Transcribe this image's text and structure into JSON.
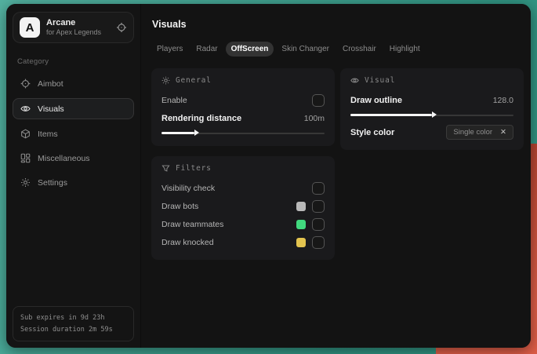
{
  "colors": {
    "background_teal": "#37a591",
    "background_red": "#dc5038",
    "swatch_gray": "#b9b9b9",
    "swatch_green": "#41d97e",
    "swatch_yellow": "#e3c44f"
  },
  "app": {
    "initial": "A",
    "name": "Arcane",
    "subtitle": "for Apex Legends"
  },
  "sidebar": {
    "category_label": "Category",
    "items": [
      {
        "label": "Aimbot",
        "icon": "crosshair-icon"
      },
      {
        "label": "Visuals",
        "icon": "eye-icon",
        "selected": true
      },
      {
        "label": "Items",
        "icon": "cube-icon"
      },
      {
        "label": "Miscellaneous",
        "icon": "grid-icon"
      },
      {
        "label": "Settings",
        "icon": "gear-icon"
      }
    ],
    "footer": {
      "sub_expires": "Sub expires in 9d 23h",
      "session_duration": "Session duration 2m 59s"
    }
  },
  "main": {
    "title": "Visuals",
    "tabs": [
      {
        "label": "Players"
      },
      {
        "label": "Radar"
      },
      {
        "label": "OffScreen",
        "active": true
      },
      {
        "label": "Skin Changer"
      },
      {
        "label": "Crosshair"
      },
      {
        "label": "Highlight"
      }
    ],
    "general": {
      "title": "General",
      "enable_label": "Enable",
      "rendering_distance_label": "Rendering distance",
      "rendering_distance_value": "100m"
    },
    "filters": {
      "title": "Filters",
      "rows": [
        {
          "label": "Visibility check"
        },
        {
          "label": "Draw bots",
          "swatch": "#b9b9b9"
        },
        {
          "label": "Draw teammates",
          "swatch": "#41d97e"
        },
        {
          "label": "Draw knocked",
          "swatch": "#e3c44f"
        }
      ]
    },
    "visual": {
      "title": "Visual",
      "draw_outline_label": "Draw outline",
      "draw_outline_value": "128.0",
      "style_color_label": "Style color",
      "style_color_value": "Single color",
      "style_color_remove": "✕"
    }
  }
}
